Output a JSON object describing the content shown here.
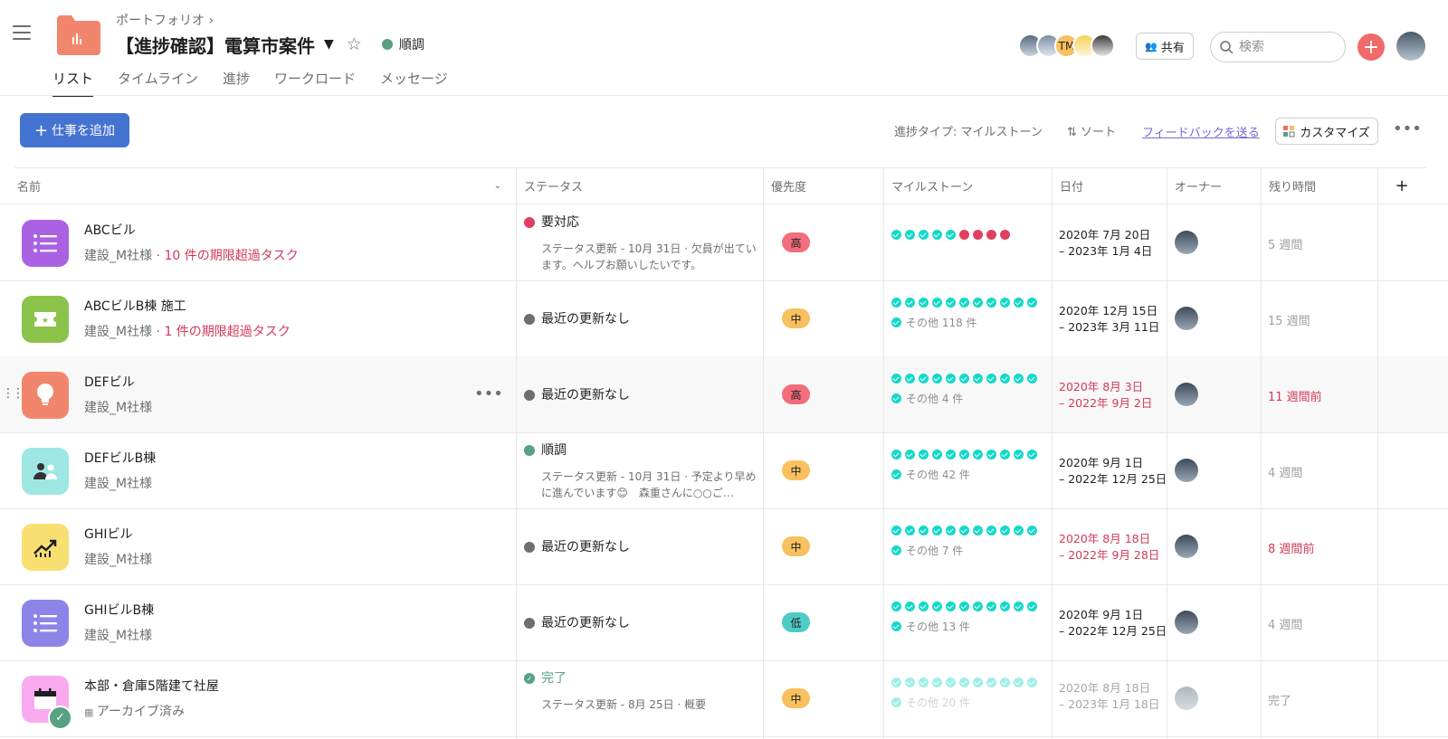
{
  "header": {
    "breadcrumb": "ポートフォリオ ›",
    "title": "【進捗確認】電算市案件",
    "status": "順調",
    "status_color": "#58a182",
    "share_label": "共有",
    "search_placeholder": "検索",
    "avatar_initials": "TM"
  },
  "tabs": [
    {
      "label": "リスト",
      "active": true
    },
    {
      "label": "タイムライン"
    },
    {
      "label": "進捗"
    },
    {
      "label": "ワークロード"
    },
    {
      "label": "メッセージ"
    }
  ],
  "toolbar": {
    "add_label": "仕事を追加",
    "progress_type": "進捗タイプ: マイルストーン",
    "sort_label": "ソート",
    "feedback_label": "フィードバックを送る",
    "customize_label": "カスタマイズ"
  },
  "columns": [
    "名前",
    "ステータス",
    "優先度",
    "マイルストーン",
    "日付",
    "オーナー",
    "残り時間"
  ],
  "rows": [
    {
      "name": "ABCビル",
      "client": "建設_M社様",
      "overdue": " · 10 件の期限超過タスク",
      "icon": "list-icon",
      "icon_color": "#aa62e3",
      "status": "要対応",
      "status_color": "#e0405e",
      "status_desc": "ステータス更新 - 10月 31日 · 欠員が出ています。ヘルプお願いしたいです。",
      "priority": "高",
      "priority_color": "#f26d7d",
      "milestones_done": 5,
      "milestones_total": 9,
      "milestones_more": "",
      "date_start": "2020年 7月 20日",
      "date_end": " – 2023年 1月 4日",
      "date_late": false,
      "remaining": "5 週間",
      "remaining_late": false
    },
    {
      "name": "ABCビルB棟 施工",
      "client": "建設_M社様",
      "overdue": " · 1 件の期限超過タスク",
      "icon": "ticket-icon",
      "icon_color": "#8bc34a",
      "status": "最近の更新なし",
      "status_color": "#6d6e6f",
      "status_desc": "",
      "priority": "中",
      "priority_color": "#f8c05e",
      "milestones_done": 11,
      "milestones_total": 11,
      "milestones_more": "その他 118 件",
      "date_start": "2020年 12月 15日",
      "date_end": " – 2023年 3月 11日",
      "date_late": false,
      "remaining": "15 週間",
      "remaining_late": false
    },
    {
      "name": "DEFビル",
      "client": "建設_M社様",
      "overdue": "",
      "icon": "lightbulb-icon",
      "icon_color": "#f1866d",
      "status": "最近の更新なし",
      "status_color": "#6d6e6f",
      "status_desc": "",
      "priority": "高",
      "priority_color": "#f26d7d",
      "milestones_done": 11,
      "milestones_total": 11,
      "milestones_more": "その他 4 件",
      "date_start": "2020年 8月 3日",
      "date_end": " – 2022年 9月 2日",
      "date_late": true,
      "remaining": "11 週間前",
      "remaining_late": true
    },
    {
      "name": "DEFビルB棟",
      "client": "建設_M社様",
      "overdue": "",
      "icon": "people-icon",
      "icon_color": "#9ee7e3",
      "status": "順調",
      "status_color": "#58a182",
      "status_desc": "ステータス更新 - 10月 31日 · 予定より早めに進んでいます😊　森重さんに○○ご…",
      "priority": "中",
      "priority_color": "#f8c05e",
      "milestones_done": 11,
      "milestones_total": 11,
      "milestones_more": "その他 42 件",
      "date_start": "2020年 9月 1日",
      "date_end": " – 2022年 12月 25日",
      "date_late": false,
      "remaining": "4 週間",
      "remaining_late": false
    },
    {
      "name": "GHIビル",
      "client": "建設_M社様",
      "overdue": "",
      "icon": "trending-up-icon",
      "icon_color": "#f8df72",
      "status": "最近の更新なし",
      "status_color": "#6d6e6f",
      "status_desc": "",
      "priority": "中",
      "priority_color": "#f8c05e",
      "milestones_done": 11,
      "milestones_total": 11,
      "milestones_more": "その他 7 件",
      "date_start": "2020年 8月 18日",
      "date_end": " – 2022年 9月 28日",
      "date_late": true,
      "remaining": "8 週間前",
      "remaining_late": true
    },
    {
      "name": "GHIビルB棟",
      "client": "建設_M社様",
      "overdue": "",
      "icon": "list-icon",
      "icon_color": "#8d84e8",
      "status": "最近の更新なし",
      "status_color": "#6d6e6f",
      "status_desc": "",
      "priority": "低",
      "priority_color": "#4ecbc4",
      "milestones_done": 11,
      "milestones_total": 11,
      "milestones_more": "その他 13 件",
      "date_start": "2020年 9月 1日",
      "date_end": " – 2022年 12月 25日",
      "date_late": false,
      "remaining": "4 週間",
      "remaining_late": false
    },
    {
      "name": "本部・倉庫5階建て社屋",
      "client": "アーカイブ済み",
      "overdue": "",
      "icon": "calendar-icon",
      "icon_color": "#f9aaef",
      "status": "完了",
      "status_color": "#58a182",
      "status_desc": "ステータス更新 - 8月 25日 · 概要",
      "priority": "中",
      "priority_color": "#f8c05e",
      "milestones_done": 11,
      "milestones_total": 11,
      "milestones_more": "その他 20 件",
      "date_start": "2020年 8月 18日",
      "date_end": " – 2023年 1月 18日",
      "date_late": false,
      "remaining": "完了",
      "remaining_late": false,
      "archived": true
    }
  ],
  "colors": {
    "accent": "#4573d2",
    "milestone_done": "#14d9c8",
    "milestone_open": "#e0405e"
  }
}
